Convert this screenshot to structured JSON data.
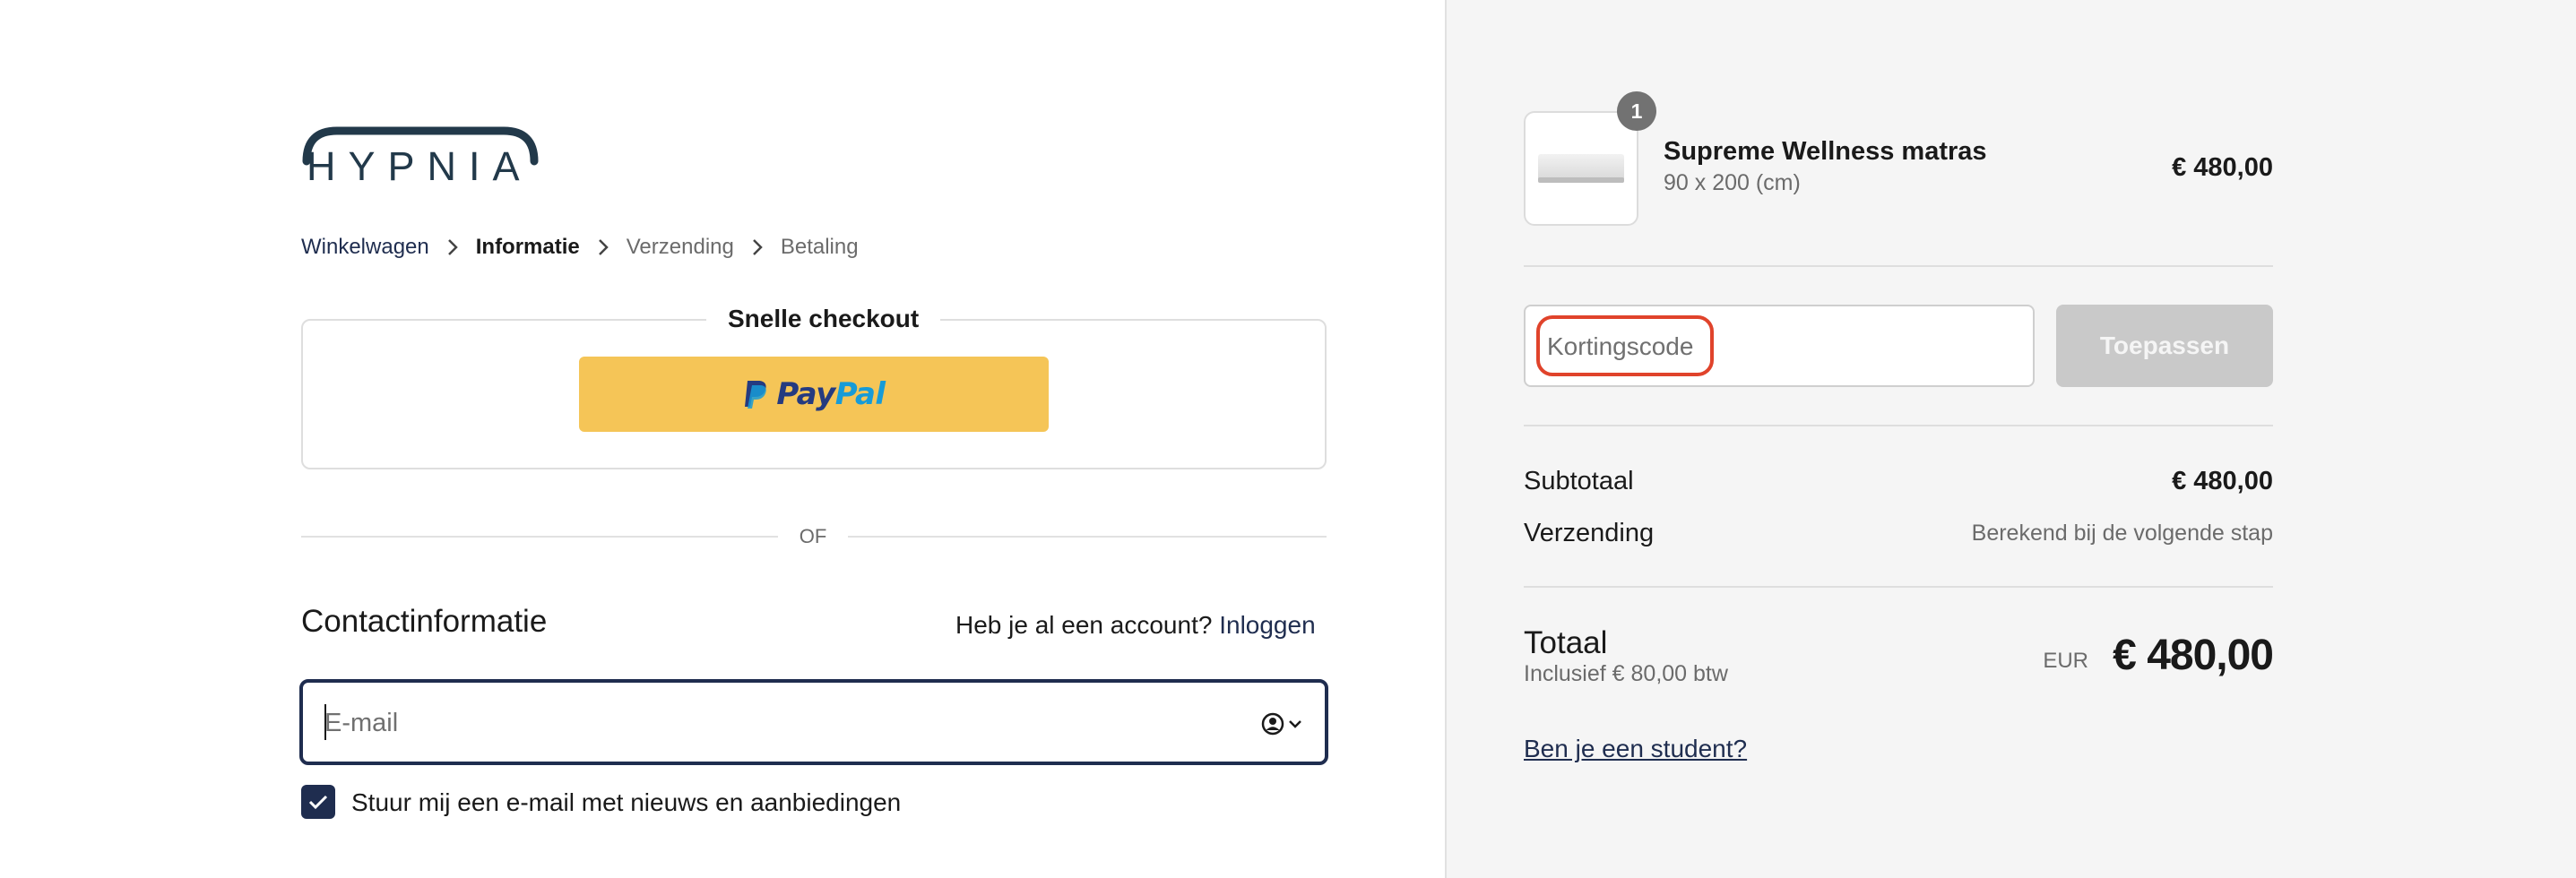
{
  "brand": {
    "logo_text": "HYPNIA"
  },
  "breadcrumb": [
    {
      "label": "Winkelwagen"
    },
    {
      "label": "Informatie"
    },
    {
      "label": "Verzending"
    },
    {
      "label": "Betaling"
    }
  ],
  "express": {
    "title": "Snelle checkout",
    "paypal_pay": "Pay",
    "paypal_pal": "Pal"
  },
  "divider": {
    "or_text": "OF"
  },
  "contact": {
    "title": "Contactinformatie",
    "account_question": "Heb je al een account?",
    "login_link": "Inloggen",
    "email_placeholder": "E-mail",
    "newsletter_label": "Stuur mij een e-mail met nieuws en aanbiedingen",
    "newsletter_checked": true
  },
  "order": {
    "item": {
      "quantity": "1",
      "name": "Supreme Wellness matras",
      "variant": "90 x 200 (cm)",
      "price": "€ 480,00"
    },
    "discount": {
      "placeholder": "Kortingscode",
      "apply_label": "Toepassen"
    },
    "subtotal_label": "Subtotaal",
    "subtotal_value": "€ 480,00",
    "shipping_label": "Verzending",
    "shipping_value": "Berekend bij de volgende stap",
    "total_label": "Totaal",
    "tax_note": "Inclusief € 80,00 btw",
    "currency": "EUR",
    "total_value": "€ 480,00",
    "student_link": "Ben je een student?"
  },
  "colors": {
    "accent": "#1f2d4f",
    "logo": "#22394a",
    "paypal_button": "#f5c557",
    "highlight": "#e0432b",
    "apply_disabled": "#c9c9c9"
  }
}
